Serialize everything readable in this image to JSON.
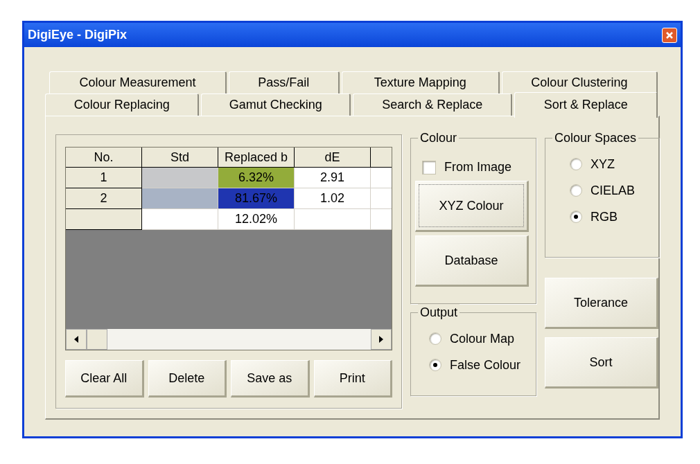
{
  "window": {
    "title": "DigiEye - DigiPix"
  },
  "tab_rows": [
    {
      "tabs": [
        {
          "label": "Colour Measurement",
          "selected": false
        },
        {
          "label": "Pass/Fail",
          "selected": false
        },
        {
          "label": "Texture Mapping",
          "selected": false
        },
        {
          "label": "Colour Clustering",
          "selected": false
        }
      ]
    },
    {
      "tabs": [
        {
          "label": "Colour Replacing",
          "selected": false
        },
        {
          "label": "Gamut Checking",
          "selected": false
        },
        {
          "label": "Search & Replace",
          "selected": false
        },
        {
          "label": "Sort & Replace",
          "selected": true
        }
      ]
    }
  ],
  "table": {
    "columns": [
      "No.",
      "Std",
      "Replaced b",
      "dE"
    ],
    "rows": [
      {
        "no": "1",
        "std": {
          "color": "#c7c8ca"
        },
        "replaced": {
          "text": "6.32%",
          "color": "#93ac3a"
        },
        "de": "2.91"
      },
      {
        "no": "2",
        "std": {
          "color": "#a8b3c5"
        },
        "replaced": {
          "text": "81.67%",
          "color": "#1f35b0"
        },
        "de": "1.02"
      },
      {
        "replaced": {
          "text": "12.02%"
        }
      }
    ]
  },
  "table_buttons": [
    "Clear All",
    "Delete",
    "Save as",
    "Print"
  ],
  "colour_group": {
    "title": "Colour",
    "from_image": {
      "label": "From Image",
      "checked": false
    },
    "buttons": [
      {
        "label": "XYZ Colour",
        "focused": true
      },
      {
        "label": "Database",
        "focused": false
      }
    ]
  },
  "colour_spaces": {
    "title": "Colour Spaces",
    "options": [
      {
        "label": "XYZ",
        "selected": false
      },
      {
        "label": "CIELAB",
        "selected": false
      },
      {
        "label": "RGB",
        "selected": true
      }
    ]
  },
  "output": {
    "title": "Output",
    "options": [
      {
        "label": "Colour Map",
        "selected": false
      },
      {
        "label": "False Colour",
        "selected": true
      }
    ]
  },
  "action_buttons": [
    "Tolerance",
    "Sort"
  ]
}
